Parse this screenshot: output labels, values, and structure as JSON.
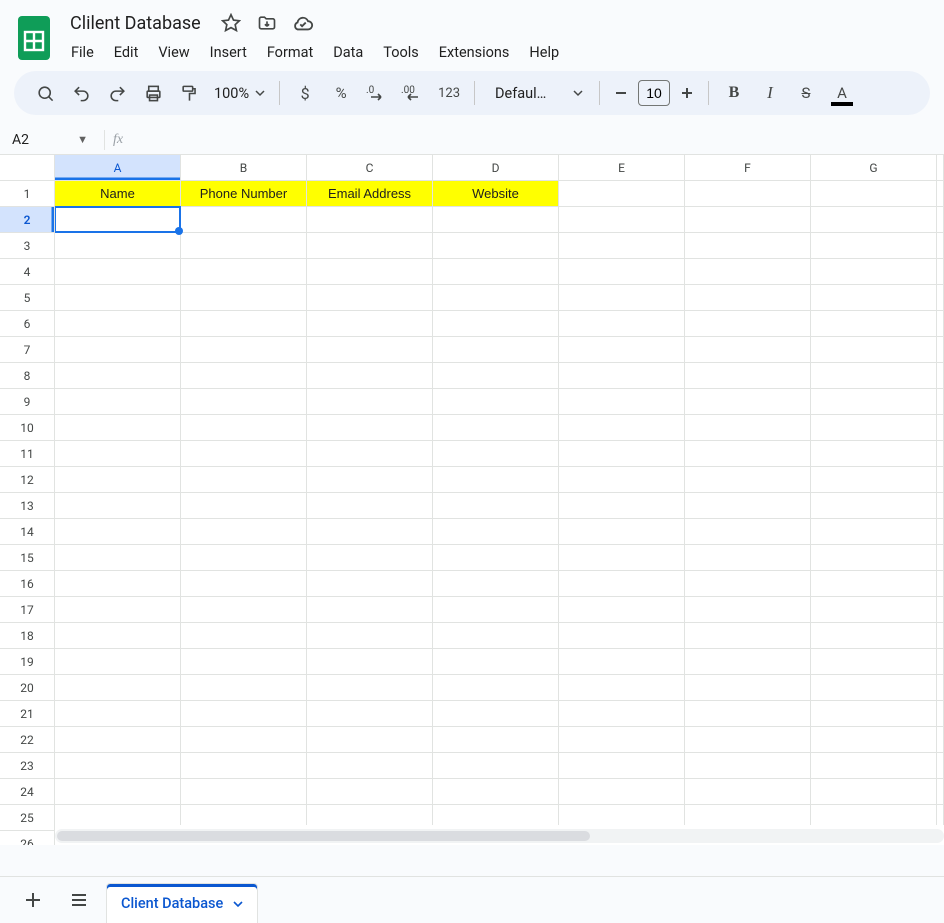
{
  "doc": {
    "title": "Clilent Database"
  },
  "menus": [
    "File",
    "Edit",
    "View",
    "Insert",
    "Format",
    "Data",
    "Tools",
    "Extensions",
    "Help"
  ],
  "toolbar": {
    "zoom": "100%",
    "num_label": "123",
    "font": "Defaul…",
    "font_size": "10"
  },
  "namebox": {
    "ref": "A2",
    "formula": ""
  },
  "grid": {
    "col_labels": [
      "A",
      "B",
      "C",
      "D",
      "E",
      "F",
      "G"
    ],
    "row_count": 26,
    "selected_col_index": 0,
    "selected_row_index": 1,
    "header_row": [
      "Name",
      "Phone Number",
      "Email Address",
      "Website"
    ],
    "header_bg": "#ffff00"
  },
  "sheet_tab": {
    "name": "Client Database"
  }
}
